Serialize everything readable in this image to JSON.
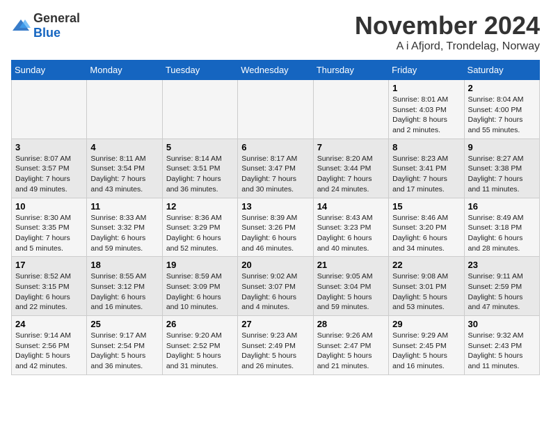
{
  "logo": {
    "general": "General",
    "blue": "Blue"
  },
  "header": {
    "month": "November 2024",
    "location": "A i Afjord, Trondelag, Norway"
  },
  "weekdays": [
    "Sunday",
    "Monday",
    "Tuesday",
    "Wednesday",
    "Thursday",
    "Friday",
    "Saturday"
  ],
  "weeks": [
    [
      {
        "day": "",
        "info": ""
      },
      {
        "day": "",
        "info": ""
      },
      {
        "day": "",
        "info": ""
      },
      {
        "day": "",
        "info": ""
      },
      {
        "day": "",
        "info": ""
      },
      {
        "day": "1",
        "info": "Sunrise: 8:01 AM\nSunset: 4:03 PM\nDaylight: 8 hours\nand 2 minutes."
      },
      {
        "day": "2",
        "info": "Sunrise: 8:04 AM\nSunset: 4:00 PM\nDaylight: 7 hours\nand 55 minutes."
      }
    ],
    [
      {
        "day": "3",
        "info": "Sunrise: 8:07 AM\nSunset: 3:57 PM\nDaylight: 7 hours\nand 49 minutes."
      },
      {
        "day": "4",
        "info": "Sunrise: 8:11 AM\nSunset: 3:54 PM\nDaylight: 7 hours\nand 43 minutes."
      },
      {
        "day": "5",
        "info": "Sunrise: 8:14 AM\nSunset: 3:51 PM\nDaylight: 7 hours\nand 36 minutes."
      },
      {
        "day": "6",
        "info": "Sunrise: 8:17 AM\nSunset: 3:47 PM\nDaylight: 7 hours\nand 30 minutes."
      },
      {
        "day": "7",
        "info": "Sunrise: 8:20 AM\nSunset: 3:44 PM\nDaylight: 7 hours\nand 24 minutes."
      },
      {
        "day": "8",
        "info": "Sunrise: 8:23 AM\nSunset: 3:41 PM\nDaylight: 7 hours\nand 17 minutes."
      },
      {
        "day": "9",
        "info": "Sunrise: 8:27 AM\nSunset: 3:38 PM\nDaylight: 7 hours\nand 11 minutes."
      }
    ],
    [
      {
        "day": "10",
        "info": "Sunrise: 8:30 AM\nSunset: 3:35 PM\nDaylight: 7 hours\nand 5 minutes."
      },
      {
        "day": "11",
        "info": "Sunrise: 8:33 AM\nSunset: 3:32 PM\nDaylight: 6 hours\nand 59 minutes."
      },
      {
        "day": "12",
        "info": "Sunrise: 8:36 AM\nSunset: 3:29 PM\nDaylight: 6 hours\nand 52 minutes."
      },
      {
        "day": "13",
        "info": "Sunrise: 8:39 AM\nSunset: 3:26 PM\nDaylight: 6 hours\nand 46 minutes."
      },
      {
        "day": "14",
        "info": "Sunrise: 8:43 AM\nSunset: 3:23 PM\nDaylight: 6 hours\nand 40 minutes."
      },
      {
        "day": "15",
        "info": "Sunrise: 8:46 AM\nSunset: 3:20 PM\nDaylight: 6 hours\nand 34 minutes."
      },
      {
        "day": "16",
        "info": "Sunrise: 8:49 AM\nSunset: 3:18 PM\nDaylight: 6 hours\nand 28 minutes."
      }
    ],
    [
      {
        "day": "17",
        "info": "Sunrise: 8:52 AM\nSunset: 3:15 PM\nDaylight: 6 hours\nand 22 minutes."
      },
      {
        "day": "18",
        "info": "Sunrise: 8:55 AM\nSunset: 3:12 PM\nDaylight: 6 hours\nand 16 minutes."
      },
      {
        "day": "19",
        "info": "Sunrise: 8:59 AM\nSunset: 3:09 PM\nDaylight: 6 hours\nand 10 minutes."
      },
      {
        "day": "20",
        "info": "Sunrise: 9:02 AM\nSunset: 3:07 PM\nDaylight: 6 hours\nand 4 minutes."
      },
      {
        "day": "21",
        "info": "Sunrise: 9:05 AM\nSunset: 3:04 PM\nDaylight: 5 hours\nand 59 minutes."
      },
      {
        "day": "22",
        "info": "Sunrise: 9:08 AM\nSunset: 3:01 PM\nDaylight: 5 hours\nand 53 minutes."
      },
      {
        "day": "23",
        "info": "Sunrise: 9:11 AM\nSunset: 2:59 PM\nDaylight: 5 hours\nand 47 minutes."
      }
    ],
    [
      {
        "day": "24",
        "info": "Sunrise: 9:14 AM\nSunset: 2:56 PM\nDaylight: 5 hours\nand 42 minutes."
      },
      {
        "day": "25",
        "info": "Sunrise: 9:17 AM\nSunset: 2:54 PM\nDaylight: 5 hours\nand 36 minutes."
      },
      {
        "day": "26",
        "info": "Sunrise: 9:20 AM\nSunset: 2:52 PM\nDaylight: 5 hours\nand 31 minutes."
      },
      {
        "day": "27",
        "info": "Sunrise: 9:23 AM\nSunset: 2:49 PM\nDaylight: 5 hours\nand 26 minutes."
      },
      {
        "day": "28",
        "info": "Sunrise: 9:26 AM\nSunset: 2:47 PM\nDaylight: 5 hours\nand 21 minutes."
      },
      {
        "day": "29",
        "info": "Sunrise: 9:29 AM\nSunset: 2:45 PM\nDaylight: 5 hours\nand 16 minutes."
      },
      {
        "day": "30",
        "info": "Sunrise: 9:32 AM\nSunset: 2:43 PM\nDaylight: 5 hours\nand 11 minutes."
      }
    ]
  ]
}
